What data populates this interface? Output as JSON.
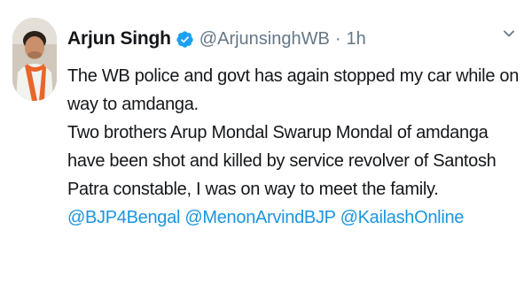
{
  "tweet": {
    "author_name": "Arjun Singh",
    "handle": "@ArjunsinghWB",
    "separator": "·",
    "time": "1h",
    "paragraphs": [
      "The WB police and govt has again stopped my car while on way to amdanga.",
      "Two brothers Arup Mondal Swarup Mondal of amdanga have been shot and killed by service revolver of Santosh Patra constable, I was on way to meet the family."
    ],
    "mentions": [
      "@BJP4Bengal",
      "@MenonArvindBJP",
      "@KailashOnline"
    ]
  },
  "icons": {
    "verified": "verified-badge-icon",
    "menu": "chevron-down-icon"
  },
  "colors": {
    "link": "#1b95e0",
    "secondary_text": "#657786",
    "verified": "#1da1f2"
  }
}
